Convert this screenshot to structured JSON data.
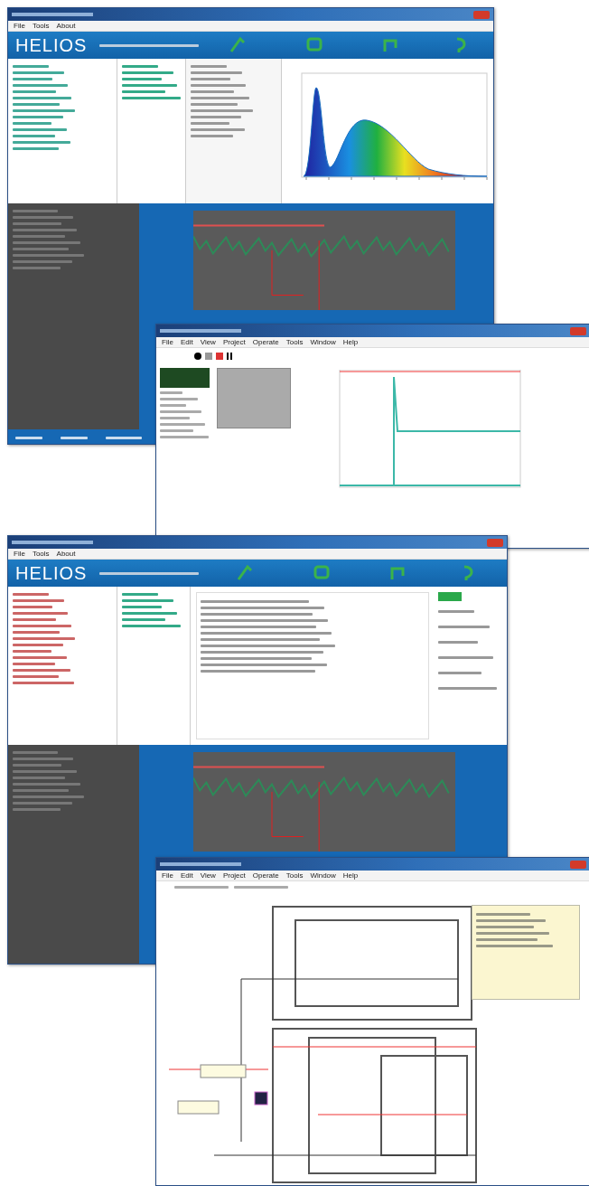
{
  "windows": [
    {
      "kind": "helios_spectrum",
      "menu": [
        "File",
        "Tools",
        "About"
      ],
      "logo": "HELIOS"
    },
    {
      "kind": "front_panel",
      "menu": [
        "File",
        "Edit",
        "View",
        "Project",
        "Operate",
        "Tools",
        "Window",
        "Help"
      ]
    },
    {
      "kind": "helios_settings",
      "menu": [
        "File",
        "Tools",
        "About"
      ],
      "logo": "HELIOS"
    },
    {
      "kind": "block_diagram",
      "menu": [
        "File",
        "Edit",
        "View",
        "Project",
        "Operate",
        "Tools",
        "Window",
        "Help"
      ]
    }
  ]
}
